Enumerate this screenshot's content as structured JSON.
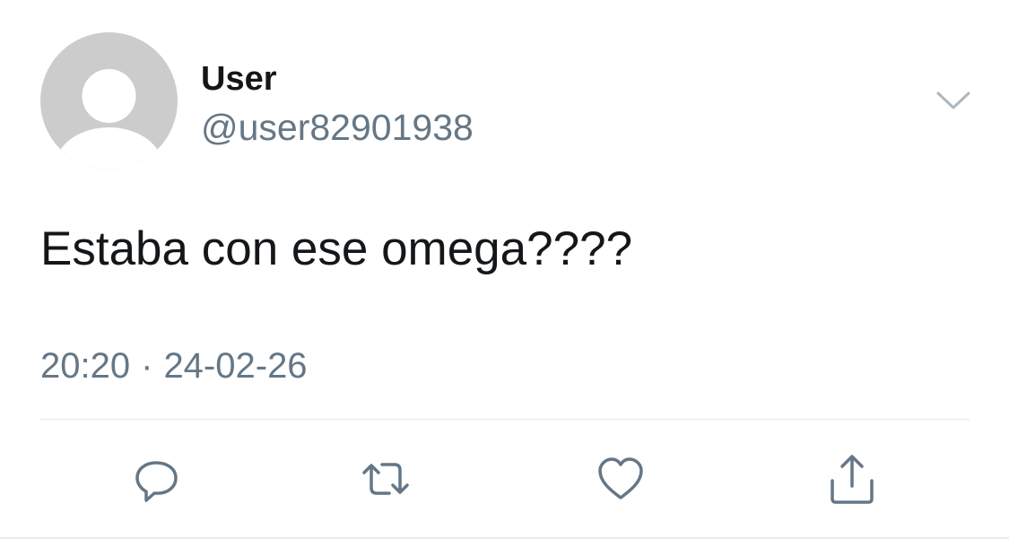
{
  "author": {
    "display_name": "User",
    "handle": "@user82901938",
    "avatar_icon": "default-user-avatar-icon"
  },
  "tweet": {
    "text": "Estaba con ese omega????",
    "time": "20:20",
    "separator": "·",
    "date": "24-02-26"
  },
  "actions": {
    "reply_icon": "reply-icon",
    "retweet_icon": "retweet-icon",
    "like_icon": "heart-icon",
    "share_icon": "share-icon"
  },
  "colors": {
    "text": "#14171a",
    "secondary": "#657786",
    "avatar_bg": "#cccccc",
    "icon": "#657786",
    "divider": "#e1e8ed"
  }
}
